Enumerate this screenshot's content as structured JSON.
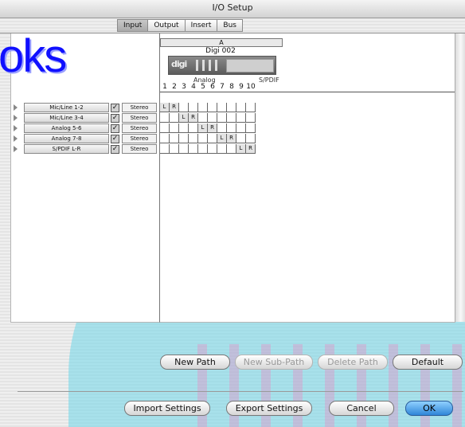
{
  "window": {
    "title": "I/O Setup"
  },
  "tabs": [
    {
      "label": "Input",
      "active": true
    },
    {
      "label": "Output",
      "active": false
    },
    {
      "label": "Insert",
      "active": false
    },
    {
      "label": "Bus",
      "active": false
    }
  ],
  "overlay_text": "oks",
  "grid_header": {
    "section": "A",
    "device": "Digi 002",
    "device_logo": "digi",
    "groups": [
      "Analog",
      "S/PDIF"
    ],
    "channels": [
      "1",
      "2",
      "3",
      "4",
      "5",
      "6",
      "7",
      "8",
      "9",
      "10"
    ]
  },
  "paths": [
    {
      "name": "Mic/Line 1-2",
      "format": "Stereo",
      "checked": true,
      "left_ch": "L",
      "right_ch": "R"
    },
    {
      "name": "Mic/Line 3-4",
      "format": "Stereo",
      "checked": true,
      "left_ch": "L",
      "right_ch": "R"
    },
    {
      "name": "Analog 5-6",
      "format": "Stereo",
      "checked": true,
      "left_ch": "L",
      "right_ch": "R"
    },
    {
      "name": "Analog 7-8",
      "format": "Stereo",
      "checked": true,
      "left_ch": "L",
      "right_ch": "R"
    },
    {
      "name": "S/PDIF L-R",
      "format": "Stereo",
      "checked": true,
      "left_ch": "L",
      "right_ch": "R"
    }
  ],
  "buttons": {
    "new_path": "New Path",
    "new_sub_path": "New Sub-Path",
    "delete_path": "Delete Path",
    "default": "Default",
    "import_settings": "Import Settings",
    "export_settings": "Export Settings",
    "cancel": "Cancel",
    "ok": "OK"
  },
  "colors": {
    "accent": "#2f86d8",
    "overlay_text": "#1010ff",
    "band": "#6ed6e7"
  },
  "icons": {
    "disclosure": "disclosure-triangle-icon",
    "checkbox": "checkbox-icon"
  }
}
